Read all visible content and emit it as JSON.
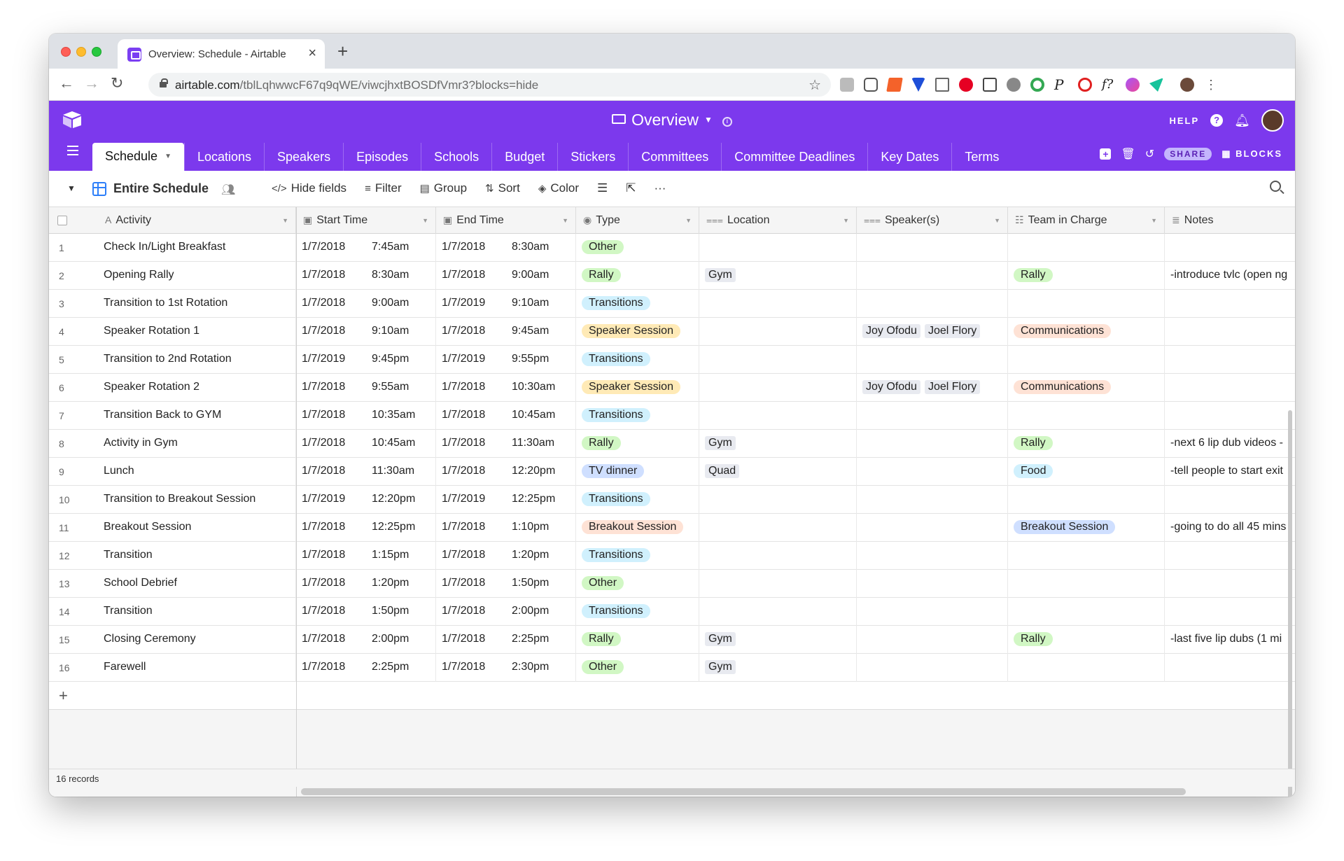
{
  "browser": {
    "tab_title": "Overview: Schedule - Airtable",
    "tab_close": "×",
    "new_tab": "+",
    "url_host": "airtable.com",
    "url_path": "/tblLqhwwcF67q9qWE/viwcjhxtBOSDfVmr3?blocks=hide",
    "back": "←",
    "forward": "→",
    "reload": "↻",
    "bookmark": "☆"
  },
  "header": {
    "base_title": "Overview",
    "help": "HELP",
    "help_icon": "?",
    "share": "SHARE",
    "blocks": "BLOCKS"
  },
  "tables": [
    {
      "label": "Schedule",
      "active": true
    },
    {
      "label": "Locations"
    },
    {
      "label": "Speakers"
    },
    {
      "label": "Episodes"
    },
    {
      "label": "Schools"
    },
    {
      "label": "Budget"
    },
    {
      "label": "Stickers"
    },
    {
      "label": "Committees"
    },
    {
      "label": "Committee Deadlines"
    },
    {
      "label": "Key Dates"
    },
    {
      "label": "Terms"
    }
  ],
  "view": {
    "name": "Entire Schedule",
    "tools": [
      {
        "label": "Hide fields",
        "icon": "eye-slash-icon"
      },
      {
        "label": "Filter",
        "icon": "filter-icon"
      },
      {
        "label": "Group",
        "icon": "group-icon"
      },
      {
        "label": "Sort",
        "icon": "sort-icon"
      },
      {
        "label": "Color",
        "icon": "paint-bucket-icon"
      }
    ]
  },
  "columns": [
    {
      "label": "Activity",
      "icon": "text-field-icon"
    },
    {
      "label": "Start Time",
      "icon": "calendar-icon"
    },
    {
      "label": "End Time",
      "icon": "calendar-icon"
    },
    {
      "label": "Type",
      "icon": "single-select-icon"
    },
    {
      "label": "Location",
      "icon": "link-icon"
    },
    {
      "label": "Speaker(s)",
      "icon": "link-icon"
    },
    {
      "label": "Team in Charge",
      "icon": "multi-select-icon"
    },
    {
      "label": "Notes",
      "icon": "long-text-icon"
    }
  ],
  "pill_colors": {
    "Other": "#d1f7c4",
    "Rally": "#d1f7c4",
    "Transitions": "#d0f0fd",
    "Speaker Session": "#ffeab6",
    "TV dinner": "#cfdfff",
    "Breakout Session": "#fee2d5",
    "Communications": "#fee2d5",
    "Food": "#d0f0fd",
    "Breakout Session Team": "#cfdfff"
  },
  "rows": [
    {
      "n": "1",
      "activity": "Check In/Light Breakfast",
      "sd": "1/7/2018",
      "st": "7:45am",
      "ed": "1/7/2018",
      "et": "8:30am",
      "type": "Other",
      "location": "",
      "speakers": [],
      "team": "",
      "notes": ""
    },
    {
      "n": "2",
      "activity": "Opening Rally",
      "sd": "1/7/2018",
      "st": "8:30am",
      "ed": "1/7/2018",
      "et": "9:00am",
      "type": "Rally",
      "location": "Gym",
      "speakers": [],
      "team": "Rally",
      "notes": "-introduce tvlc (open ng"
    },
    {
      "n": "3",
      "activity": "Transition to 1st Rotation",
      "sd": "1/7/2018",
      "st": "9:00am",
      "ed": "1/7/2019",
      "et": "9:10am",
      "type": "Transitions",
      "location": "",
      "speakers": [],
      "team": "",
      "notes": ""
    },
    {
      "n": "4",
      "activity": "Speaker Rotation 1",
      "sd": "1/7/2018",
      "st": "9:10am",
      "ed": "1/7/2018",
      "et": "9:45am",
      "type": "Speaker Session",
      "location": "",
      "speakers": [
        "Joy Ofodu",
        "Joel Flory"
      ],
      "team": "Communications",
      "notes": ""
    },
    {
      "n": "5",
      "activity": "Transition to 2nd Rotation",
      "sd": "1/7/2019",
      "st": "9:45pm",
      "ed": "1/7/2019",
      "et": "9:55pm",
      "type": "Transitions",
      "location": "",
      "speakers": [],
      "team": "",
      "notes": ""
    },
    {
      "n": "6",
      "activity": "Speaker Rotation 2",
      "sd": "1/7/2018",
      "st": "9:55am",
      "ed": "1/7/2018",
      "et": "10:30am",
      "type": "Speaker Session",
      "location": "",
      "speakers": [
        "Joy Ofodu",
        "Joel Flory"
      ],
      "team": "Communications",
      "notes": ""
    },
    {
      "n": "7",
      "activity": "Transition Back to GYM",
      "sd": "1/7/2018",
      "st": "10:35am",
      "ed": "1/7/2018",
      "et": "10:45am",
      "type": "Transitions",
      "location": "",
      "speakers": [],
      "team": "",
      "notes": ""
    },
    {
      "n": "8",
      "activity": "Activity in Gym",
      "sd": "1/7/2018",
      "st": "10:45am",
      "ed": "1/7/2018",
      "et": "11:30am",
      "type": "Rally",
      "location": "Gym",
      "speakers": [],
      "team": "Rally",
      "notes": "-next 6 lip dub videos -"
    },
    {
      "n": "9",
      "activity": "Lunch",
      "sd": "1/7/2018",
      "st": "11:30am",
      "ed": "1/7/2018",
      "et": "12:20pm",
      "type": "TV dinner",
      "location": "Quad",
      "speakers": [],
      "team": "Food",
      "notes": "-tell people to start exit"
    },
    {
      "n": "10",
      "activity": "Transition to Breakout Session",
      "sd": "1/7/2019",
      "st": "12:20pm",
      "ed": "1/7/2019",
      "et": "12:25pm",
      "type": "Transitions",
      "location": "",
      "speakers": [],
      "team": "",
      "notes": ""
    },
    {
      "n": "11",
      "activity": "Breakout Session",
      "sd": "1/7/2018",
      "st": "12:25pm",
      "ed": "1/7/2018",
      "et": "1:10pm",
      "type": "Breakout Session",
      "location": "",
      "speakers": [],
      "team": "Breakout Session",
      "notes": "-going to do all 45 mins"
    },
    {
      "n": "12",
      "activity": "Transition",
      "sd": "1/7/2018",
      "st": "1:15pm",
      "ed": "1/7/2018",
      "et": "1:20pm",
      "type": "Transitions",
      "location": "",
      "speakers": [],
      "team": "",
      "notes": ""
    },
    {
      "n": "13",
      "activity": "School Debrief",
      "sd": "1/7/2018",
      "st": "1:20pm",
      "ed": "1/7/2018",
      "et": "1:50pm",
      "type": "Other",
      "location": "",
      "speakers": [],
      "team": "",
      "notes": ""
    },
    {
      "n": "14",
      "activity": "Transition",
      "sd": "1/7/2018",
      "st": "1:50pm",
      "ed": "1/7/2018",
      "et": "2:00pm",
      "type": "Transitions",
      "location": "",
      "speakers": [],
      "team": "",
      "notes": ""
    },
    {
      "n": "15",
      "activity": "Closing Ceremony",
      "sd": "1/7/2018",
      "st": "2:00pm",
      "ed": "1/7/2018",
      "et": "2:25pm",
      "type": "Rally",
      "location": "Gym",
      "speakers": [],
      "team": "Rally",
      "notes": "-last five lip dubs (1 mi"
    },
    {
      "n": "16",
      "activity": "Farewell",
      "sd": "1/7/2018",
      "st": "2:25pm",
      "ed": "1/7/2018",
      "et": "2:30pm",
      "type": "Other",
      "location": "Gym",
      "speakers": [],
      "team": "",
      "notes": ""
    }
  ],
  "footer": {
    "records": "16 records",
    "add_row": "+"
  }
}
